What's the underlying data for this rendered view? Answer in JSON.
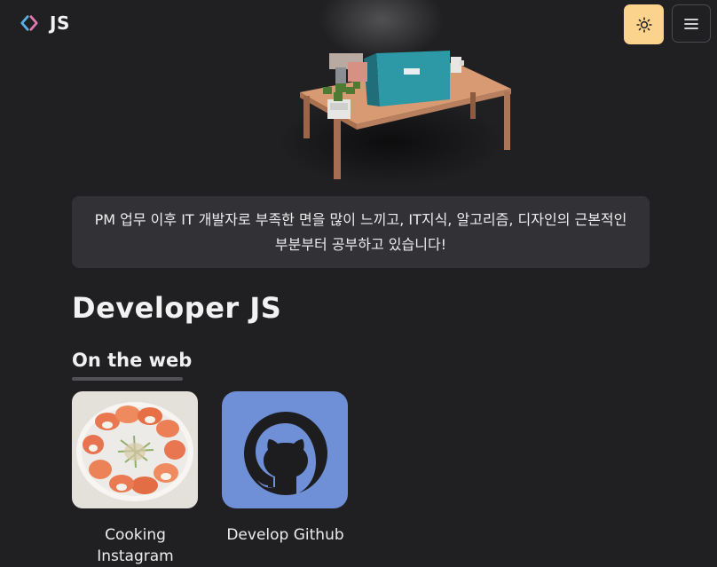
{
  "nav": {
    "logo_text": "JS",
    "theme_icon": "sun-icon",
    "menu_icon": "hamburger-icon"
  },
  "hero": {
    "image": "voxel-desk-illustration"
  },
  "bio": {
    "text": "PM 업무 이후 IT 개발자로 부족한 면을 많이 느끼고, IT지식, 알고리즘, 디자인의 근본적인 부분부터 공부하고 있습니다!"
  },
  "page_title": "Developer JS",
  "section": {
    "heading": "On the web"
  },
  "links": [
    {
      "label": "Cooking Instagram",
      "thumbnail": "sushi-photo"
    },
    {
      "label": "Develop Github",
      "thumbnail": "github-icon"
    }
  ],
  "colors": {
    "background": "#202023",
    "bio_background": "#323236",
    "theme_button": "#fbd38d",
    "github_tile": "#6f8fd6"
  }
}
